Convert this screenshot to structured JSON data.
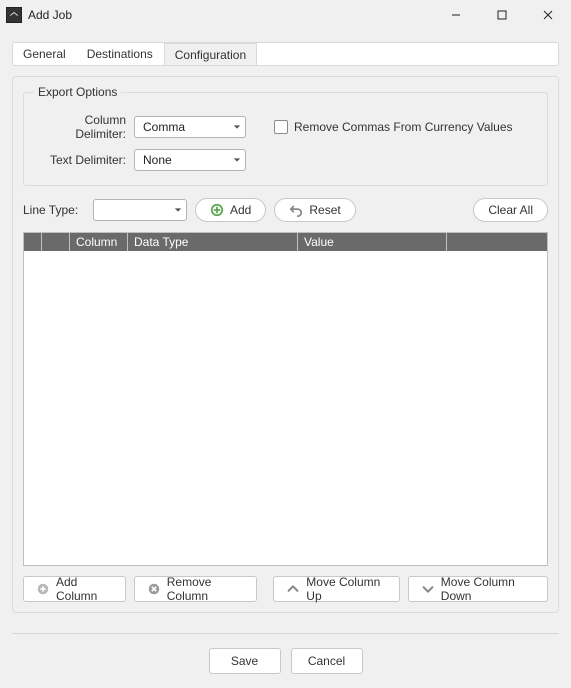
{
  "window": {
    "title": "Add Job"
  },
  "tabs": [
    {
      "label": "General"
    },
    {
      "label": "Destinations"
    },
    {
      "label": "Configuration"
    }
  ],
  "export_options": {
    "legend": "Export Options",
    "column_delimiter_label": "Column Delimiter:",
    "column_delimiter_value": "Comma",
    "text_delimiter_label": "Text Delimiter:",
    "text_delimiter_value": "None",
    "remove_commas_label": "Remove Commas From Currency Values",
    "remove_commas_checked": false
  },
  "line_type": {
    "label": "Line Type:",
    "value": ""
  },
  "buttons": {
    "add": "Add",
    "reset": "Reset",
    "clear_all": "Clear All",
    "add_column": "Add Column",
    "remove_column": "Remove Column",
    "move_up": "Move Column Up",
    "move_down": "Move Column Down",
    "save": "Save",
    "cancel": "Cancel"
  },
  "grid": {
    "headers": [
      "",
      "",
      "Column",
      "Data Type",
      "Value",
      ""
    ],
    "rows": []
  }
}
